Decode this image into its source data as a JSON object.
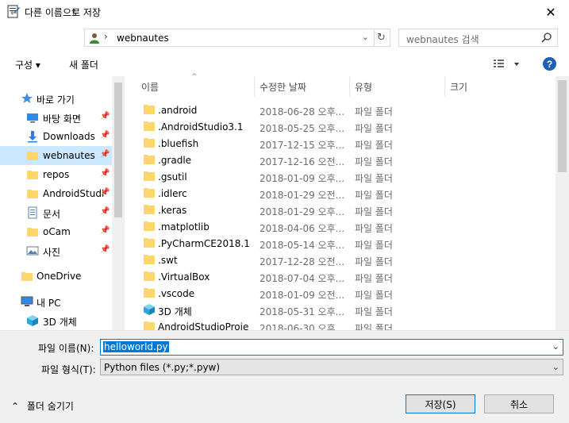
{
  "window": {
    "title": "다른 이름으로 저장",
    "close_glyph": "✕"
  },
  "nav": {
    "back_glyph": "←",
    "forward_glyph": "→",
    "recent_glyph": "⌄",
    "up_glyph": "↑",
    "breadcrumb_sep": "›",
    "breadcrumb": "webnautes",
    "address_dropdown_glyph": "⌄",
    "refresh_glyph": "↻",
    "search_placeholder": "webnautes 검색"
  },
  "toolbar": {
    "organize": "구성 ▾",
    "new_folder": "새 폴더",
    "help": "?"
  },
  "sidebar": {
    "quick_access": "바로 가기",
    "items": [
      {
        "label": "바탕 화면",
        "icon": "desktop-icon",
        "pinned": true
      },
      {
        "label": "Downloads",
        "icon": "download-icon",
        "pinned": true
      },
      {
        "label": "webnautes",
        "icon": "folder-icon",
        "pinned": true,
        "selected": true
      },
      {
        "label": "repos",
        "icon": "folder-icon",
        "pinned": true
      },
      {
        "label": "AndroidStudi",
        "icon": "folder-icon",
        "pinned": true
      },
      {
        "label": "문서",
        "icon": "document-icon",
        "pinned": true
      },
      {
        "label": "oCam",
        "icon": "folder-icon",
        "pinned": true
      },
      {
        "label": "사진",
        "icon": "pictures-icon",
        "pinned": true
      }
    ],
    "onedrive": "OneDrive",
    "this_pc": "내 PC",
    "objects3d": "3D 개체"
  },
  "columns": {
    "name": "이름",
    "modified": "수정한 날짜",
    "type": "유형",
    "size": "크기"
  },
  "files": [
    {
      "name": ".android",
      "date": "2018-06-28 오후...",
      "type": "파일 폴더"
    },
    {
      "name": ".AndroidStudio3.1",
      "date": "2018-05-25 오후...",
      "type": "파일 폴더"
    },
    {
      "name": ".bluefish",
      "date": "2017-12-15 오후...",
      "type": "파일 폴더"
    },
    {
      "name": ".gradle",
      "date": "2017-12-16 오전...",
      "type": "파일 폴더"
    },
    {
      "name": ".gsutil",
      "date": "2018-01-09 오후...",
      "type": "파일 폴더"
    },
    {
      "name": ".idlerc",
      "date": "2018-01-29 오전...",
      "type": "파일 폴더"
    },
    {
      "name": ".keras",
      "date": "2018-01-29 오후...",
      "type": "파일 폴더"
    },
    {
      "name": ".matplotlib",
      "date": "2018-04-06 오후...",
      "type": "파일 폴더"
    },
    {
      "name": ".PyCharmCE2018.1",
      "date": "2018-05-14 오후...",
      "type": "파일 폴더"
    },
    {
      "name": ".swt",
      "date": "2017-12-28 오전...",
      "type": "파일 폴더"
    },
    {
      "name": ".VirtualBox",
      "date": "2018-07-04 오후...",
      "type": "파일 폴더"
    },
    {
      "name": ".vscode",
      "date": "2018-01-09 오전...",
      "type": "파일 폴더"
    },
    {
      "name": "3D 개체",
      "date": "2018-05-31 오후...",
      "type": "파일 폴더",
      "special": true
    },
    {
      "name": "AndroidStudioProje",
      "date": "2018-06-30 오후...",
      "type": "파일 폴더"
    }
  ],
  "footer": {
    "filename_label": "파일 이름(N):",
    "filename_value": "helloworld.py",
    "filetype_label": "파일 형식(T):",
    "filetype_value": "Python files (*.py;*.pyw)",
    "hide_folders": "폴더 숨기기",
    "hide_folders_glyph": "⌃",
    "dropdown_glyph": "⌄",
    "save": "저장(S)",
    "cancel": "취소"
  },
  "colors": {
    "accent": "#0078d7",
    "folder": "#ffd66b",
    "selected": "#cce8ff"
  }
}
